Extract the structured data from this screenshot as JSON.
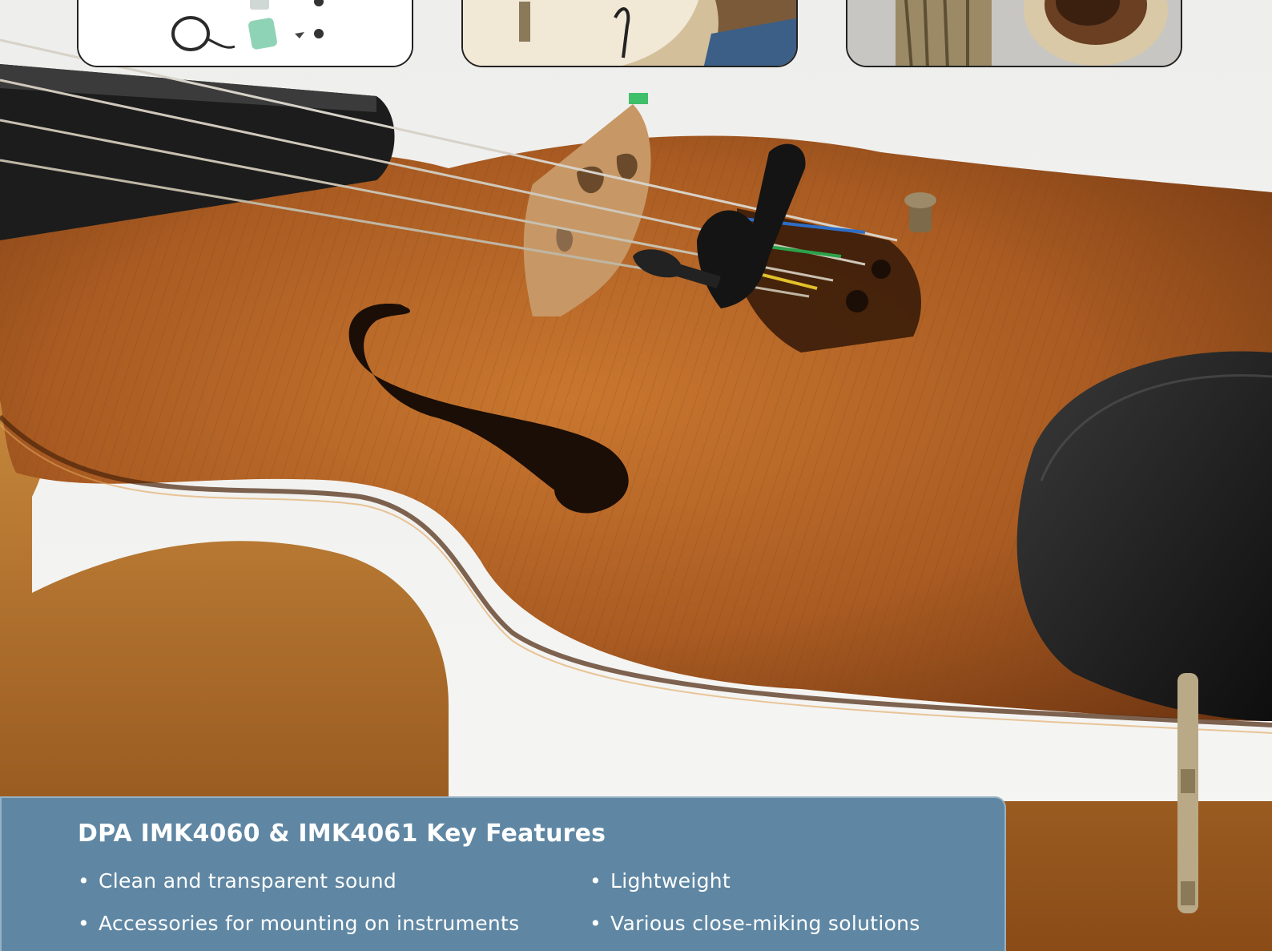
{
  "thumbnails": [
    {
      "subject": "microphone kit with cable and accessories"
    },
    {
      "subject": "acoustic guitar with mounted microphone"
    },
    {
      "subject": "saxophone bell"
    }
  ],
  "photo": {
    "subject": "violin with clip-mounted miniature microphone near bridge"
  },
  "features": {
    "title": "DPA IMK4060 & IMK4061 Key Features",
    "bullet": "•",
    "items": [
      "Clean and transparent sound",
      "Accessories for mounting on instruments",
      "Lightweight",
      "Various close-miking solutions"
    ]
  },
  "colors": {
    "panel": "#5f87a3",
    "text": "#ffffff",
    "wood": "#b8672a",
    "background": "#e9e8e4"
  }
}
